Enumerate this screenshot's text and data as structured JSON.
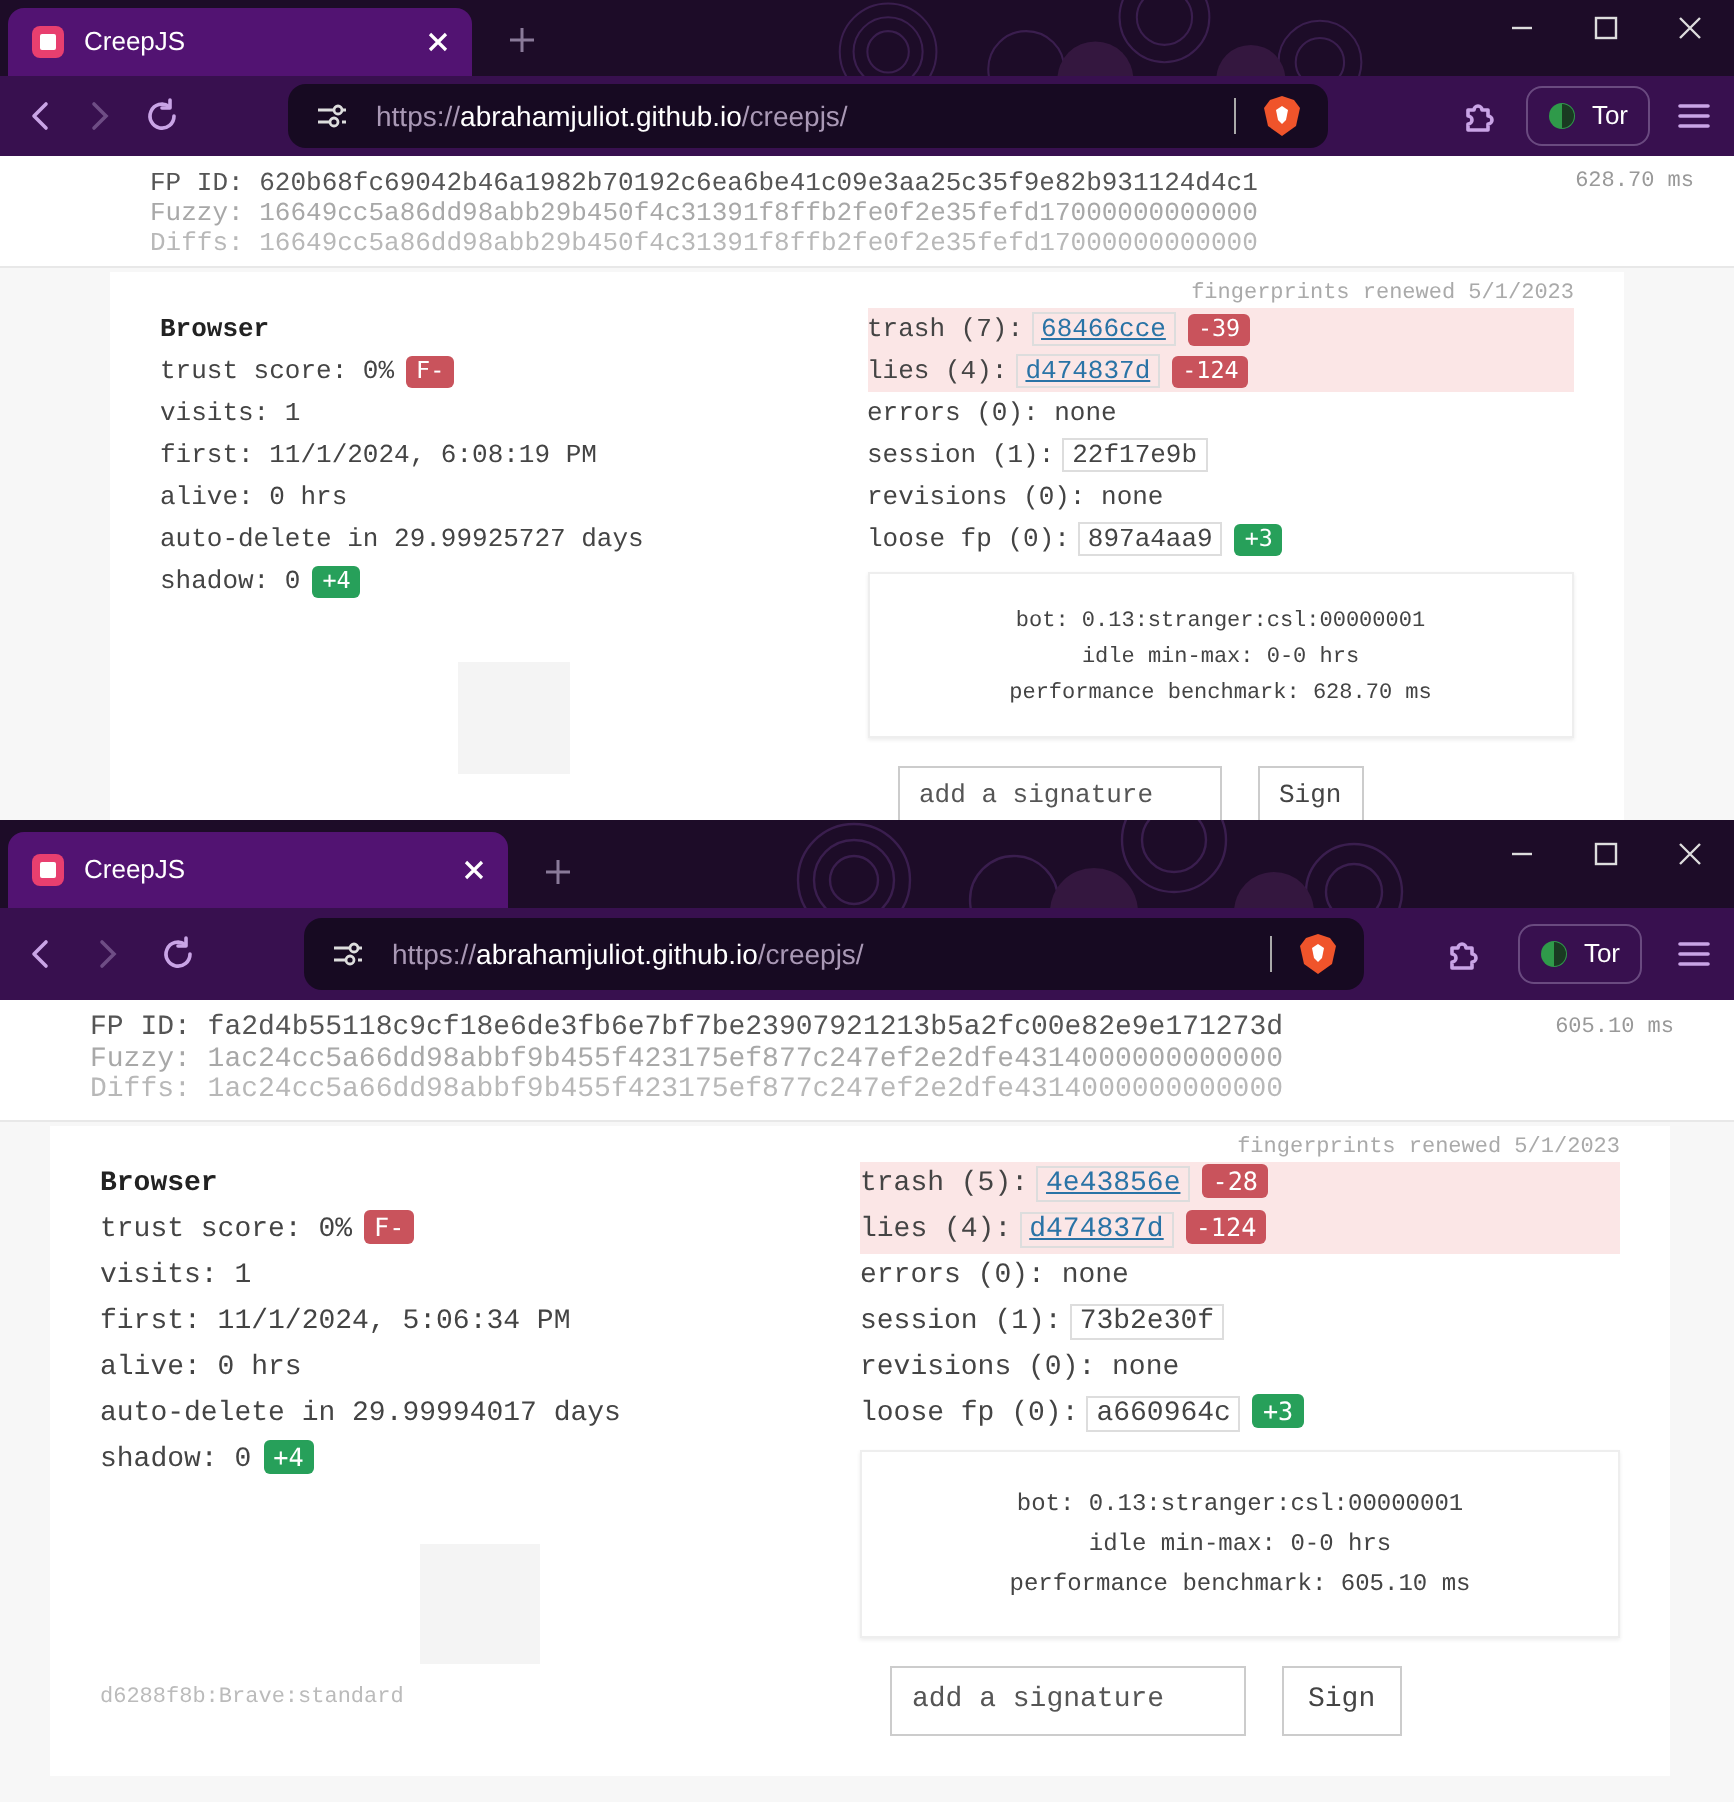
{
  "windows": [
    {
      "tab_title": "CreepJS",
      "url": {
        "scheme": "https://",
        "host": "abrahamjuliot.github.io",
        "path": "/creepjs/"
      },
      "tor_label": "Tor",
      "hashes": {
        "fp_id": "FP ID: 620b68fc69042b46a1982b70192c6ea6be41c09e3aa25c35f9e82b931124d4c1",
        "fuzzy": "Fuzzy: 16649cc5a86dd98abb29b450f4c31391f8ffb2fe0f2e35fefd17000000000000",
        "diffs": "Diffs: 16649cc5a86dd98abb29b450f4c31391f8ffb2fe0f2e35fefd17000000000000",
        "time": "628.70 ms"
      },
      "renewed": "fingerprints renewed 5/1/2023",
      "browser": {
        "heading": "Browser",
        "lines": [
          {
            "text": "trust score: 0%",
            "badge": {
              "text": "F-",
              "color": "#c9535c"
            }
          },
          {
            "text": "visits: 1"
          },
          {
            "text": "first: 11/1/2024, 6:08:19 PM"
          },
          {
            "text": "alive: 0 hrs"
          },
          {
            "text": "auto-delete in 29.99925727 days"
          },
          {
            "text": "shadow: 0",
            "badge": {
              "text": "+4",
              "color": "#27a05a"
            }
          }
        ]
      },
      "stats": [
        {
          "label": "trash (7):",
          "value": "68466cce",
          "kind": "link",
          "flagged": true,
          "badge": {
            "text": "-39",
            "color": "#c9535c"
          }
        },
        {
          "label": "lies (4):",
          "value": "d474837d",
          "kind": "link",
          "flagged": true,
          "badge": {
            "text": "-124",
            "color": "#c9535c"
          }
        },
        {
          "label": "errors (0):",
          "value": "none",
          "kind": "text",
          "flagged": false
        },
        {
          "label": "session (1):",
          "value": "22f17e9b",
          "kind": "boxed",
          "flagged": false
        },
        {
          "label": "revisions (0):",
          "value": "none",
          "kind": "text",
          "flagged": false
        },
        {
          "label": "loose fp (0):",
          "value": "897a4aa9",
          "kind": "boxed",
          "flagged": false,
          "badge": {
            "text": "+3",
            "color": "#27a05a"
          }
        }
      ],
      "info": [
        "bot: 0.13:stranger:csl:00000001",
        "idle min-max: 0-0 hrs",
        "performance benchmark: 628.70 ms"
      ],
      "signature": {
        "placeholder": "add a signature",
        "button": "Sign"
      }
    },
    {
      "tab_title": "CreepJS",
      "url": {
        "scheme": "https://",
        "host": "abrahamjuliot.github.io",
        "path": "/creepjs/"
      },
      "tor_label": "Tor",
      "hashes": {
        "fp_id": "FP ID: fa2d4b55118c9cf18e6de3fb6e7bf7be23907921213b5a2fc00e82e9e171273d",
        "fuzzy": "Fuzzy: 1ac24cc5a66dd98abbf9b455f423175ef877c247ef2e2dfe4314000000000000",
        "diffs": "Diffs: 1ac24cc5a66dd98abbf9b455f423175ef877c247ef2e2dfe4314000000000000",
        "time": "605.10 ms"
      },
      "renewed": "fingerprints renewed 5/1/2023",
      "browser": {
        "heading": "Browser",
        "lines": [
          {
            "text": "trust score: 0%",
            "badge": {
              "text": "F-",
              "color": "#c9535c"
            }
          },
          {
            "text": "visits: 1"
          },
          {
            "text": "first: 11/1/2024, 5:06:34 PM"
          },
          {
            "text": "alive: 0 hrs"
          },
          {
            "text": "auto-delete in 29.99994017 days"
          },
          {
            "text": "shadow: 0",
            "badge": {
              "text": "+4",
              "color": "#27a05a"
            }
          }
        ]
      },
      "stats": [
        {
          "label": "trash (5):",
          "value": "4e43856e",
          "kind": "link",
          "flagged": true,
          "badge": {
            "text": "-28",
            "color": "#c9535c"
          }
        },
        {
          "label": "lies (4):",
          "value": "d474837d",
          "kind": "link",
          "flagged": true,
          "badge": {
            "text": "-124",
            "color": "#c9535c"
          }
        },
        {
          "label": "errors (0):",
          "value": "none",
          "kind": "text",
          "flagged": false
        },
        {
          "label": "session (1):",
          "value": "73b2e30f",
          "kind": "boxed",
          "flagged": false
        },
        {
          "label": "revisions (0):",
          "value": "none",
          "kind": "text",
          "flagged": false
        },
        {
          "label": "loose fp (0):",
          "value": "a660964c",
          "kind": "boxed",
          "flagged": false,
          "badge": {
            "text": "+3",
            "color": "#27a05a"
          }
        }
      ],
      "info": [
        "bot: 0.13:stranger:csl:00000001",
        "idle min-max: 0-0 hrs",
        "performance benchmark: 605.10 ms"
      ],
      "signature": {
        "placeholder": "add a signature",
        "button": "Sign"
      },
      "footer": "d6288f8b:Brave:standard"
    }
  ]
}
